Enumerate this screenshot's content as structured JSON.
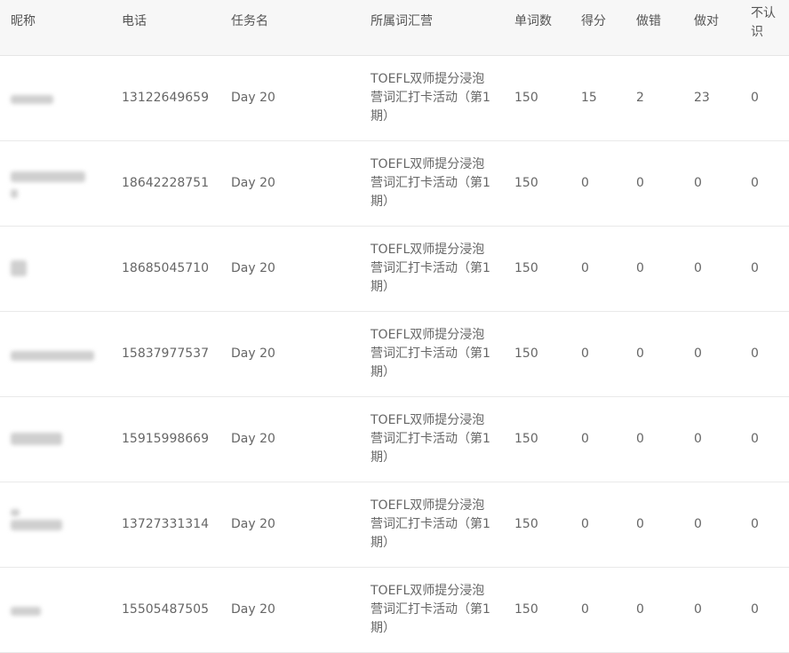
{
  "columns": {
    "nickname": "昵称",
    "phone": "电话",
    "task": "任务名",
    "camp": "所属词汇营",
    "word_count": "单词数",
    "score": "得分",
    "wrong": "做错",
    "right": "做对",
    "unknown": "不认识"
  },
  "rows": [
    {
      "phone": "13122649659",
      "task": "Day 20",
      "camp": "TOEFL双师提分浸泡营词汇打卡活动（第1期）",
      "word_count": "150",
      "score": "15",
      "wrong": "2",
      "right": "23",
      "unknown": "0"
    },
    {
      "phone": "18642228751",
      "task": "Day 20",
      "camp": "TOEFL双师提分浸泡营词汇打卡活动（第1期）",
      "word_count": "150",
      "score": "0",
      "wrong": "0",
      "right": "0",
      "unknown": "0"
    },
    {
      "phone": "18685045710",
      "task": "Day 20",
      "camp": "TOEFL双师提分浸泡营词汇打卡活动（第1期）",
      "word_count": "150",
      "score": "0",
      "wrong": "0",
      "right": "0",
      "unknown": "0"
    },
    {
      "phone": "15837977537",
      "task": "Day 20",
      "camp": "TOEFL双师提分浸泡营词汇打卡活动（第1期）",
      "word_count": "150",
      "score": "0",
      "wrong": "0",
      "right": "0",
      "unknown": "0"
    },
    {
      "phone": "15915998669",
      "task": "Day 20",
      "camp": "TOEFL双师提分浸泡营词汇打卡活动（第1期）",
      "word_count": "150",
      "score": "0",
      "wrong": "0",
      "right": "0",
      "unknown": "0"
    },
    {
      "phone": "13727331314",
      "task": "Day 20",
      "camp": "TOEFL双师提分浸泡营词汇打卡活动（第1期）",
      "word_count": "150",
      "score": "0",
      "wrong": "0",
      "right": "0",
      "unknown": "0"
    },
    {
      "phone": "15505487505",
      "task": "Day 20",
      "camp": "TOEFL双师提分浸泡营词汇打卡活动（第1期）",
      "word_count": "150",
      "score": "0",
      "wrong": "0",
      "right": "0",
      "unknown": "0"
    }
  ]
}
